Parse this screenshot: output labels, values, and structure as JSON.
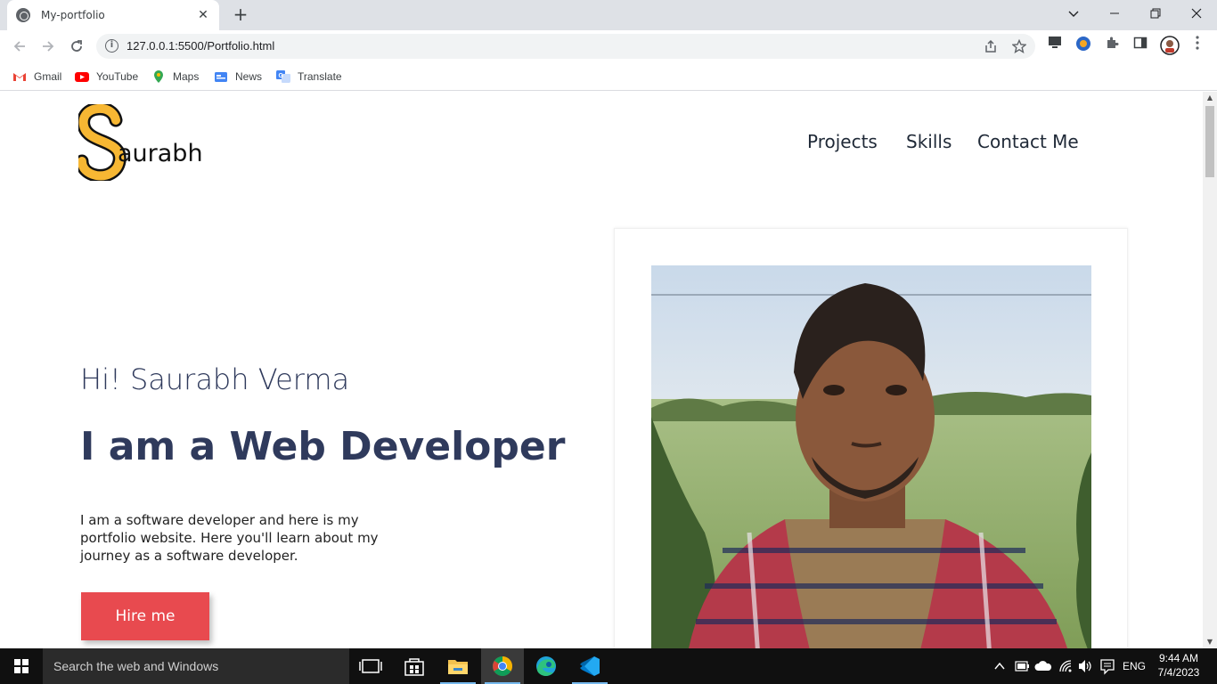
{
  "browser": {
    "tab_title": "My-portfolio",
    "tab_close_glyph": "✕",
    "new_tab_glyph": "+",
    "url": "127.0.0.1:5500/Portfolio.html",
    "bookmarks": [
      {
        "label": "Gmail",
        "icon": "gmail-icon",
        "color": "#ea4335"
      },
      {
        "label": "YouTube",
        "icon": "youtube-icon",
        "color": "#ff0000"
      },
      {
        "label": "Maps",
        "icon": "maps-icon",
        "color": "#34a853"
      },
      {
        "label": "News",
        "icon": "news-icon",
        "color": "#4285f4"
      },
      {
        "label": "Translate",
        "icon": "translate-icon",
        "color": "#4285f4"
      }
    ]
  },
  "page": {
    "logo_letter": "S",
    "logo_name": "aurabh",
    "nav": [
      "Projects",
      "Skills",
      "Contact Me"
    ],
    "greeting": "Hi! Saurabh Verma",
    "role": "I am a Web Developer",
    "intro": "I am a software developer and here is my portfolio website. Here you'll learn about my journey as a software developer.",
    "cta": "Hire me",
    "colors": {
      "accent": "#e84a4f",
      "heading": "#2f3a5c",
      "logo_yellow": "#f7b733"
    }
  },
  "taskbar": {
    "search_placeholder": "Search the web and Windows",
    "language": "ENG",
    "time": "9:44 AM",
    "date": "7/4/2023"
  }
}
